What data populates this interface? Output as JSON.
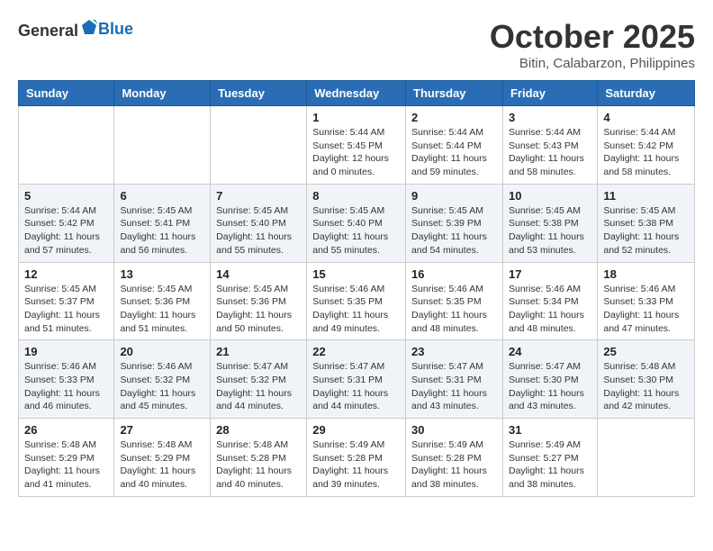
{
  "header": {
    "logo_general": "General",
    "logo_blue": "Blue",
    "month_title": "October 2025",
    "location": "Bitin, Calabarzon, Philippines"
  },
  "weekdays": [
    "Sunday",
    "Monday",
    "Tuesday",
    "Wednesday",
    "Thursday",
    "Friday",
    "Saturday"
  ],
  "weeks": [
    [
      {
        "day": "",
        "sunrise": "",
        "sunset": "",
        "daylight": ""
      },
      {
        "day": "",
        "sunrise": "",
        "sunset": "",
        "daylight": ""
      },
      {
        "day": "",
        "sunrise": "",
        "sunset": "",
        "daylight": ""
      },
      {
        "day": "1",
        "sunrise": "Sunrise: 5:44 AM",
        "sunset": "Sunset: 5:45 PM",
        "daylight": "Daylight: 12 hours and 0 minutes."
      },
      {
        "day": "2",
        "sunrise": "Sunrise: 5:44 AM",
        "sunset": "Sunset: 5:44 PM",
        "daylight": "Daylight: 11 hours and 59 minutes."
      },
      {
        "day": "3",
        "sunrise": "Sunrise: 5:44 AM",
        "sunset": "Sunset: 5:43 PM",
        "daylight": "Daylight: 11 hours and 58 minutes."
      },
      {
        "day": "4",
        "sunrise": "Sunrise: 5:44 AM",
        "sunset": "Sunset: 5:42 PM",
        "daylight": "Daylight: 11 hours and 58 minutes."
      }
    ],
    [
      {
        "day": "5",
        "sunrise": "Sunrise: 5:44 AM",
        "sunset": "Sunset: 5:42 PM",
        "daylight": "Daylight: 11 hours and 57 minutes."
      },
      {
        "day": "6",
        "sunrise": "Sunrise: 5:45 AM",
        "sunset": "Sunset: 5:41 PM",
        "daylight": "Daylight: 11 hours and 56 minutes."
      },
      {
        "day": "7",
        "sunrise": "Sunrise: 5:45 AM",
        "sunset": "Sunset: 5:40 PM",
        "daylight": "Daylight: 11 hours and 55 minutes."
      },
      {
        "day": "8",
        "sunrise": "Sunrise: 5:45 AM",
        "sunset": "Sunset: 5:40 PM",
        "daylight": "Daylight: 11 hours and 55 minutes."
      },
      {
        "day": "9",
        "sunrise": "Sunrise: 5:45 AM",
        "sunset": "Sunset: 5:39 PM",
        "daylight": "Daylight: 11 hours and 54 minutes."
      },
      {
        "day": "10",
        "sunrise": "Sunrise: 5:45 AM",
        "sunset": "Sunset: 5:38 PM",
        "daylight": "Daylight: 11 hours and 53 minutes."
      },
      {
        "day": "11",
        "sunrise": "Sunrise: 5:45 AM",
        "sunset": "Sunset: 5:38 PM",
        "daylight": "Daylight: 11 hours and 52 minutes."
      }
    ],
    [
      {
        "day": "12",
        "sunrise": "Sunrise: 5:45 AM",
        "sunset": "Sunset: 5:37 PM",
        "daylight": "Daylight: 11 hours and 51 minutes."
      },
      {
        "day": "13",
        "sunrise": "Sunrise: 5:45 AM",
        "sunset": "Sunset: 5:36 PM",
        "daylight": "Daylight: 11 hours and 51 minutes."
      },
      {
        "day": "14",
        "sunrise": "Sunrise: 5:45 AM",
        "sunset": "Sunset: 5:36 PM",
        "daylight": "Daylight: 11 hours and 50 minutes."
      },
      {
        "day": "15",
        "sunrise": "Sunrise: 5:46 AM",
        "sunset": "Sunset: 5:35 PM",
        "daylight": "Daylight: 11 hours and 49 minutes."
      },
      {
        "day": "16",
        "sunrise": "Sunrise: 5:46 AM",
        "sunset": "Sunset: 5:35 PM",
        "daylight": "Daylight: 11 hours and 48 minutes."
      },
      {
        "day": "17",
        "sunrise": "Sunrise: 5:46 AM",
        "sunset": "Sunset: 5:34 PM",
        "daylight": "Daylight: 11 hours and 48 minutes."
      },
      {
        "day": "18",
        "sunrise": "Sunrise: 5:46 AM",
        "sunset": "Sunset: 5:33 PM",
        "daylight": "Daylight: 11 hours and 47 minutes."
      }
    ],
    [
      {
        "day": "19",
        "sunrise": "Sunrise: 5:46 AM",
        "sunset": "Sunset: 5:33 PM",
        "daylight": "Daylight: 11 hours and 46 minutes."
      },
      {
        "day": "20",
        "sunrise": "Sunrise: 5:46 AM",
        "sunset": "Sunset: 5:32 PM",
        "daylight": "Daylight: 11 hours and 45 minutes."
      },
      {
        "day": "21",
        "sunrise": "Sunrise: 5:47 AM",
        "sunset": "Sunset: 5:32 PM",
        "daylight": "Daylight: 11 hours and 44 minutes."
      },
      {
        "day": "22",
        "sunrise": "Sunrise: 5:47 AM",
        "sunset": "Sunset: 5:31 PM",
        "daylight": "Daylight: 11 hours and 44 minutes."
      },
      {
        "day": "23",
        "sunrise": "Sunrise: 5:47 AM",
        "sunset": "Sunset: 5:31 PM",
        "daylight": "Daylight: 11 hours and 43 minutes."
      },
      {
        "day": "24",
        "sunrise": "Sunrise: 5:47 AM",
        "sunset": "Sunset: 5:30 PM",
        "daylight": "Daylight: 11 hours and 43 minutes."
      },
      {
        "day": "25",
        "sunrise": "Sunrise: 5:48 AM",
        "sunset": "Sunset: 5:30 PM",
        "daylight": "Daylight: 11 hours and 42 minutes."
      }
    ],
    [
      {
        "day": "26",
        "sunrise": "Sunrise: 5:48 AM",
        "sunset": "Sunset: 5:29 PM",
        "daylight": "Daylight: 11 hours and 41 minutes."
      },
      {
        "day": "27",
        "sunrise": "Sunrise: 5:48 AM",
        "sunset": "Sunset: 5:29 PM",
        "daylight": "Daylight: 11 hours and 40 minutes."
      },
      {
        "day": "28",
        "sunrise": "Sunrise: 5:48 AM",
        "sunset": "Sunset: 5:28 PM",
        "daylight": "Daylight: 11 hours and 40 minutes."
      },
      {
        "day": "29",
        "sunrise": "Sunrise: 5:49 AM",
        "sunset": "Sunset: 5:28 PM",
        "daylight": "Daylight: 11 hours and 39 minutes."
      },
      {
        "day": "30",
        "sunrise": "Sunrise: 5:49 AM",
        "sunset": "Sunset: 5:28 PM",
        "daylight": "Daylight: 11 hours and 38 minutes."
      },
      {
        "day": "31",
        "sunrise": "Sunrise: 5:49 AM",
        "sunset": "Sunset: 5:27 PM",
        "daylight": "Daylight: 11 hours and 38 minutes."
      },
      {
        "day": "",
        "sunrise": "",
        "sunset": "",
        "daylight": ""
      }
    ]
  ]
}
